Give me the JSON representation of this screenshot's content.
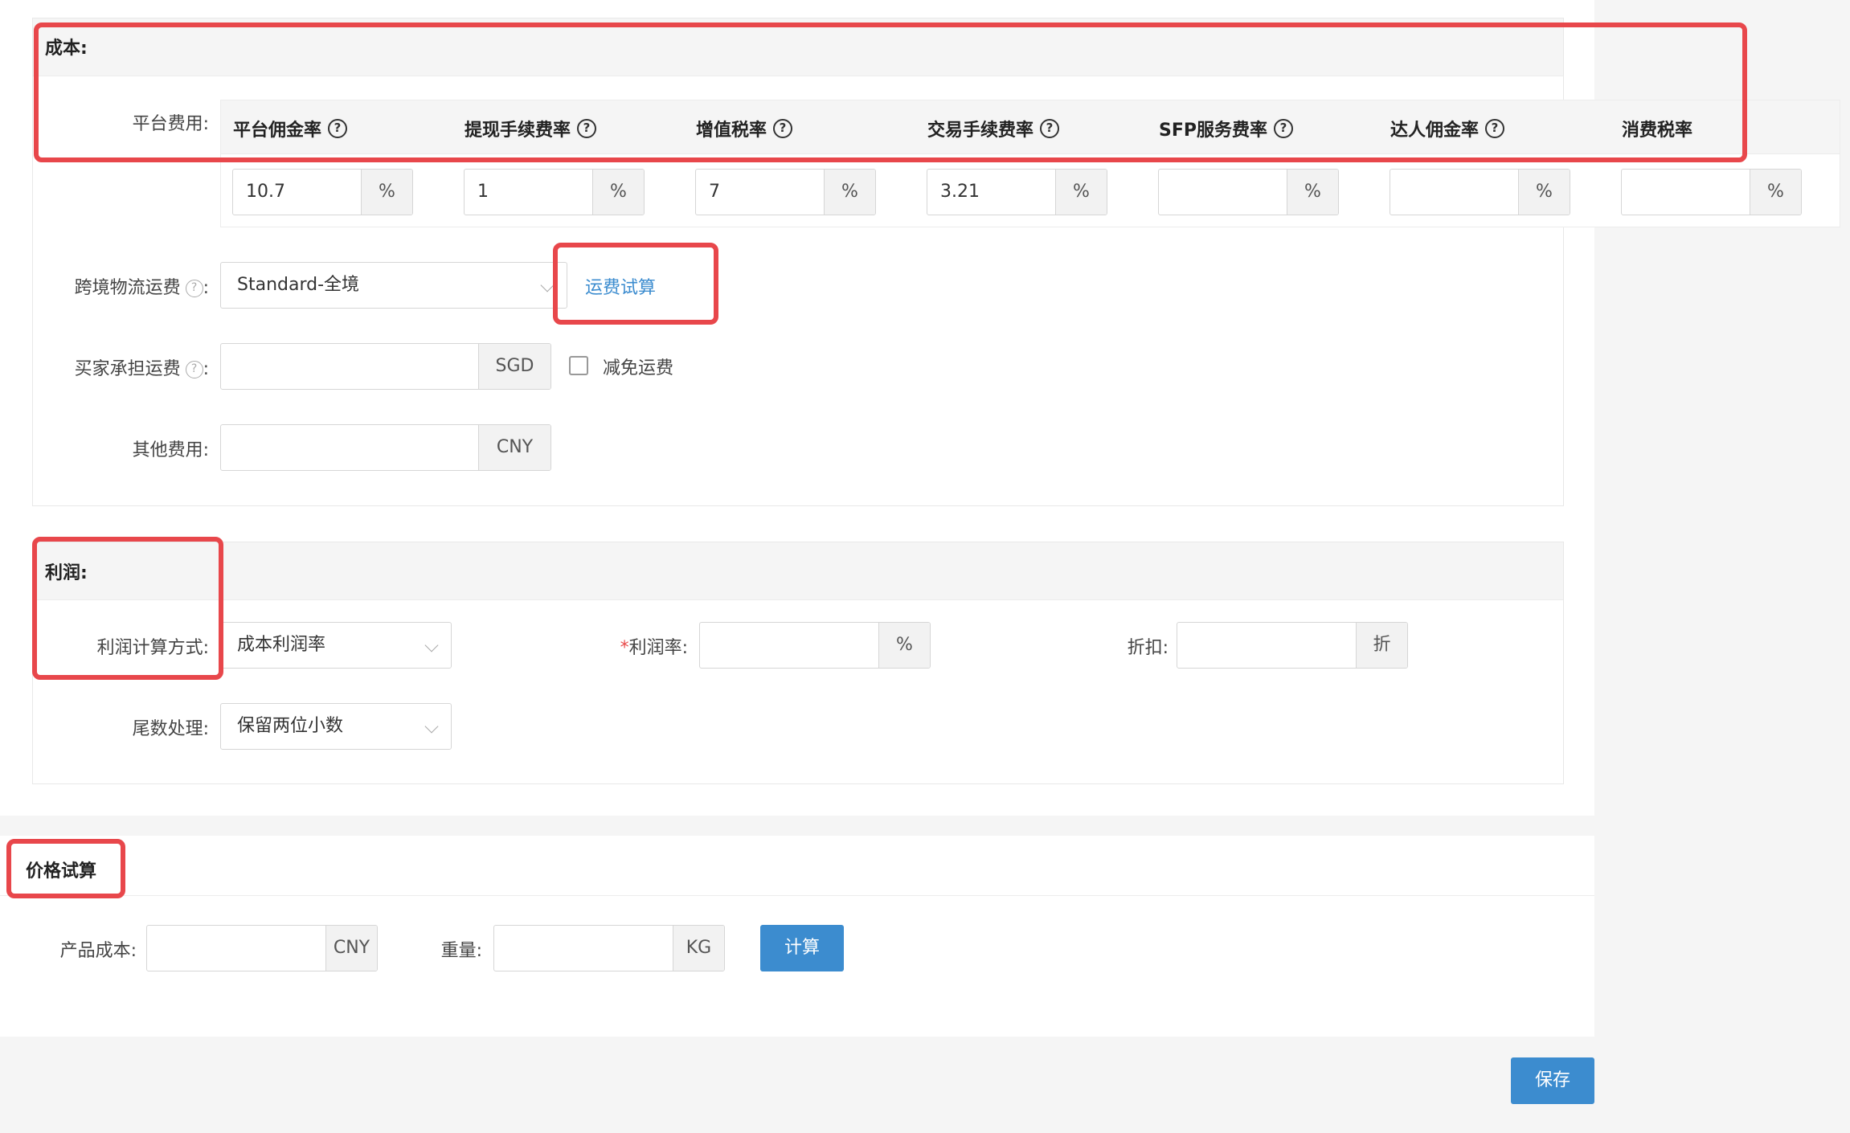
{
  "cost": {
    "title": "成本:",
    "platform_fee_label": "平台费用:",
    "columns": [
      {
        "header": "平台佣金率",
        "value": "10.7",
        "unit": "%"
      },
      {
        "header": "提现手续费率",
        "value": "1",
        "unit": "%"
      },
      {
        "header": "增值税率",
        "value": "7",
        "unit": "%"
      },
      {
        "header": "交易手续费率",
        "value": "3.21",
        "unit": "%"
      },
      {
        "header": "SFP服务费率",
        "value": "",
        "unit": "%"
      },
      {
        "header": "达人佣金率",
        "value": "",
        "unit": "%"
      },
      {
        "header": "消费税率",
        "value": "",
        "unit": "%"
      }
    ],
    "logistics_label": "跨境物流运费",
    "logistics_value": "Standard-全境",
    "freight_trial_link": "运费试算",
    "buyer_shipping_label": "买家承担运费",
    "buyer_shipping_value": "",
    "buyer_shipping_unit": "SGD",
    "waive_shipping_label": "减免运费",
    "other_fee_label": "其他费用:",
    "other_fee_value": "",
    "other_fee_unit": "CNY"
  },
  "profit": {
    "title": "利润:",
    "calc_method_label": "利润计算方式:",
    "calc_method_value": "成本利润率",
    "profit_rate_required": "*",
    "profit_rate_label": "利润率:",
    "profit_rate_value": "",
    "profit_rate_unit": "%",
    "discount_label": "折扣:",
    "discount_value": "",
    "discount_unit": "折",
    "rounding_label": "尾数处理:",
    "rounding_value": "保留两位小数"
  },
  "price_trial": {
    "title": "价格试算",
    "product_cost_label": "产品成本:",
    "product_cost_value": "",
    "product_cost_unit": "CNY",
    "weight_label": "重量:",
    "weight_value": "",
    "weight_unit": "KG",
    "calculate_button": "计算"
  },
  "save_button": "保存",
  "colon": ":",
  "help_glyph": "?"
}
